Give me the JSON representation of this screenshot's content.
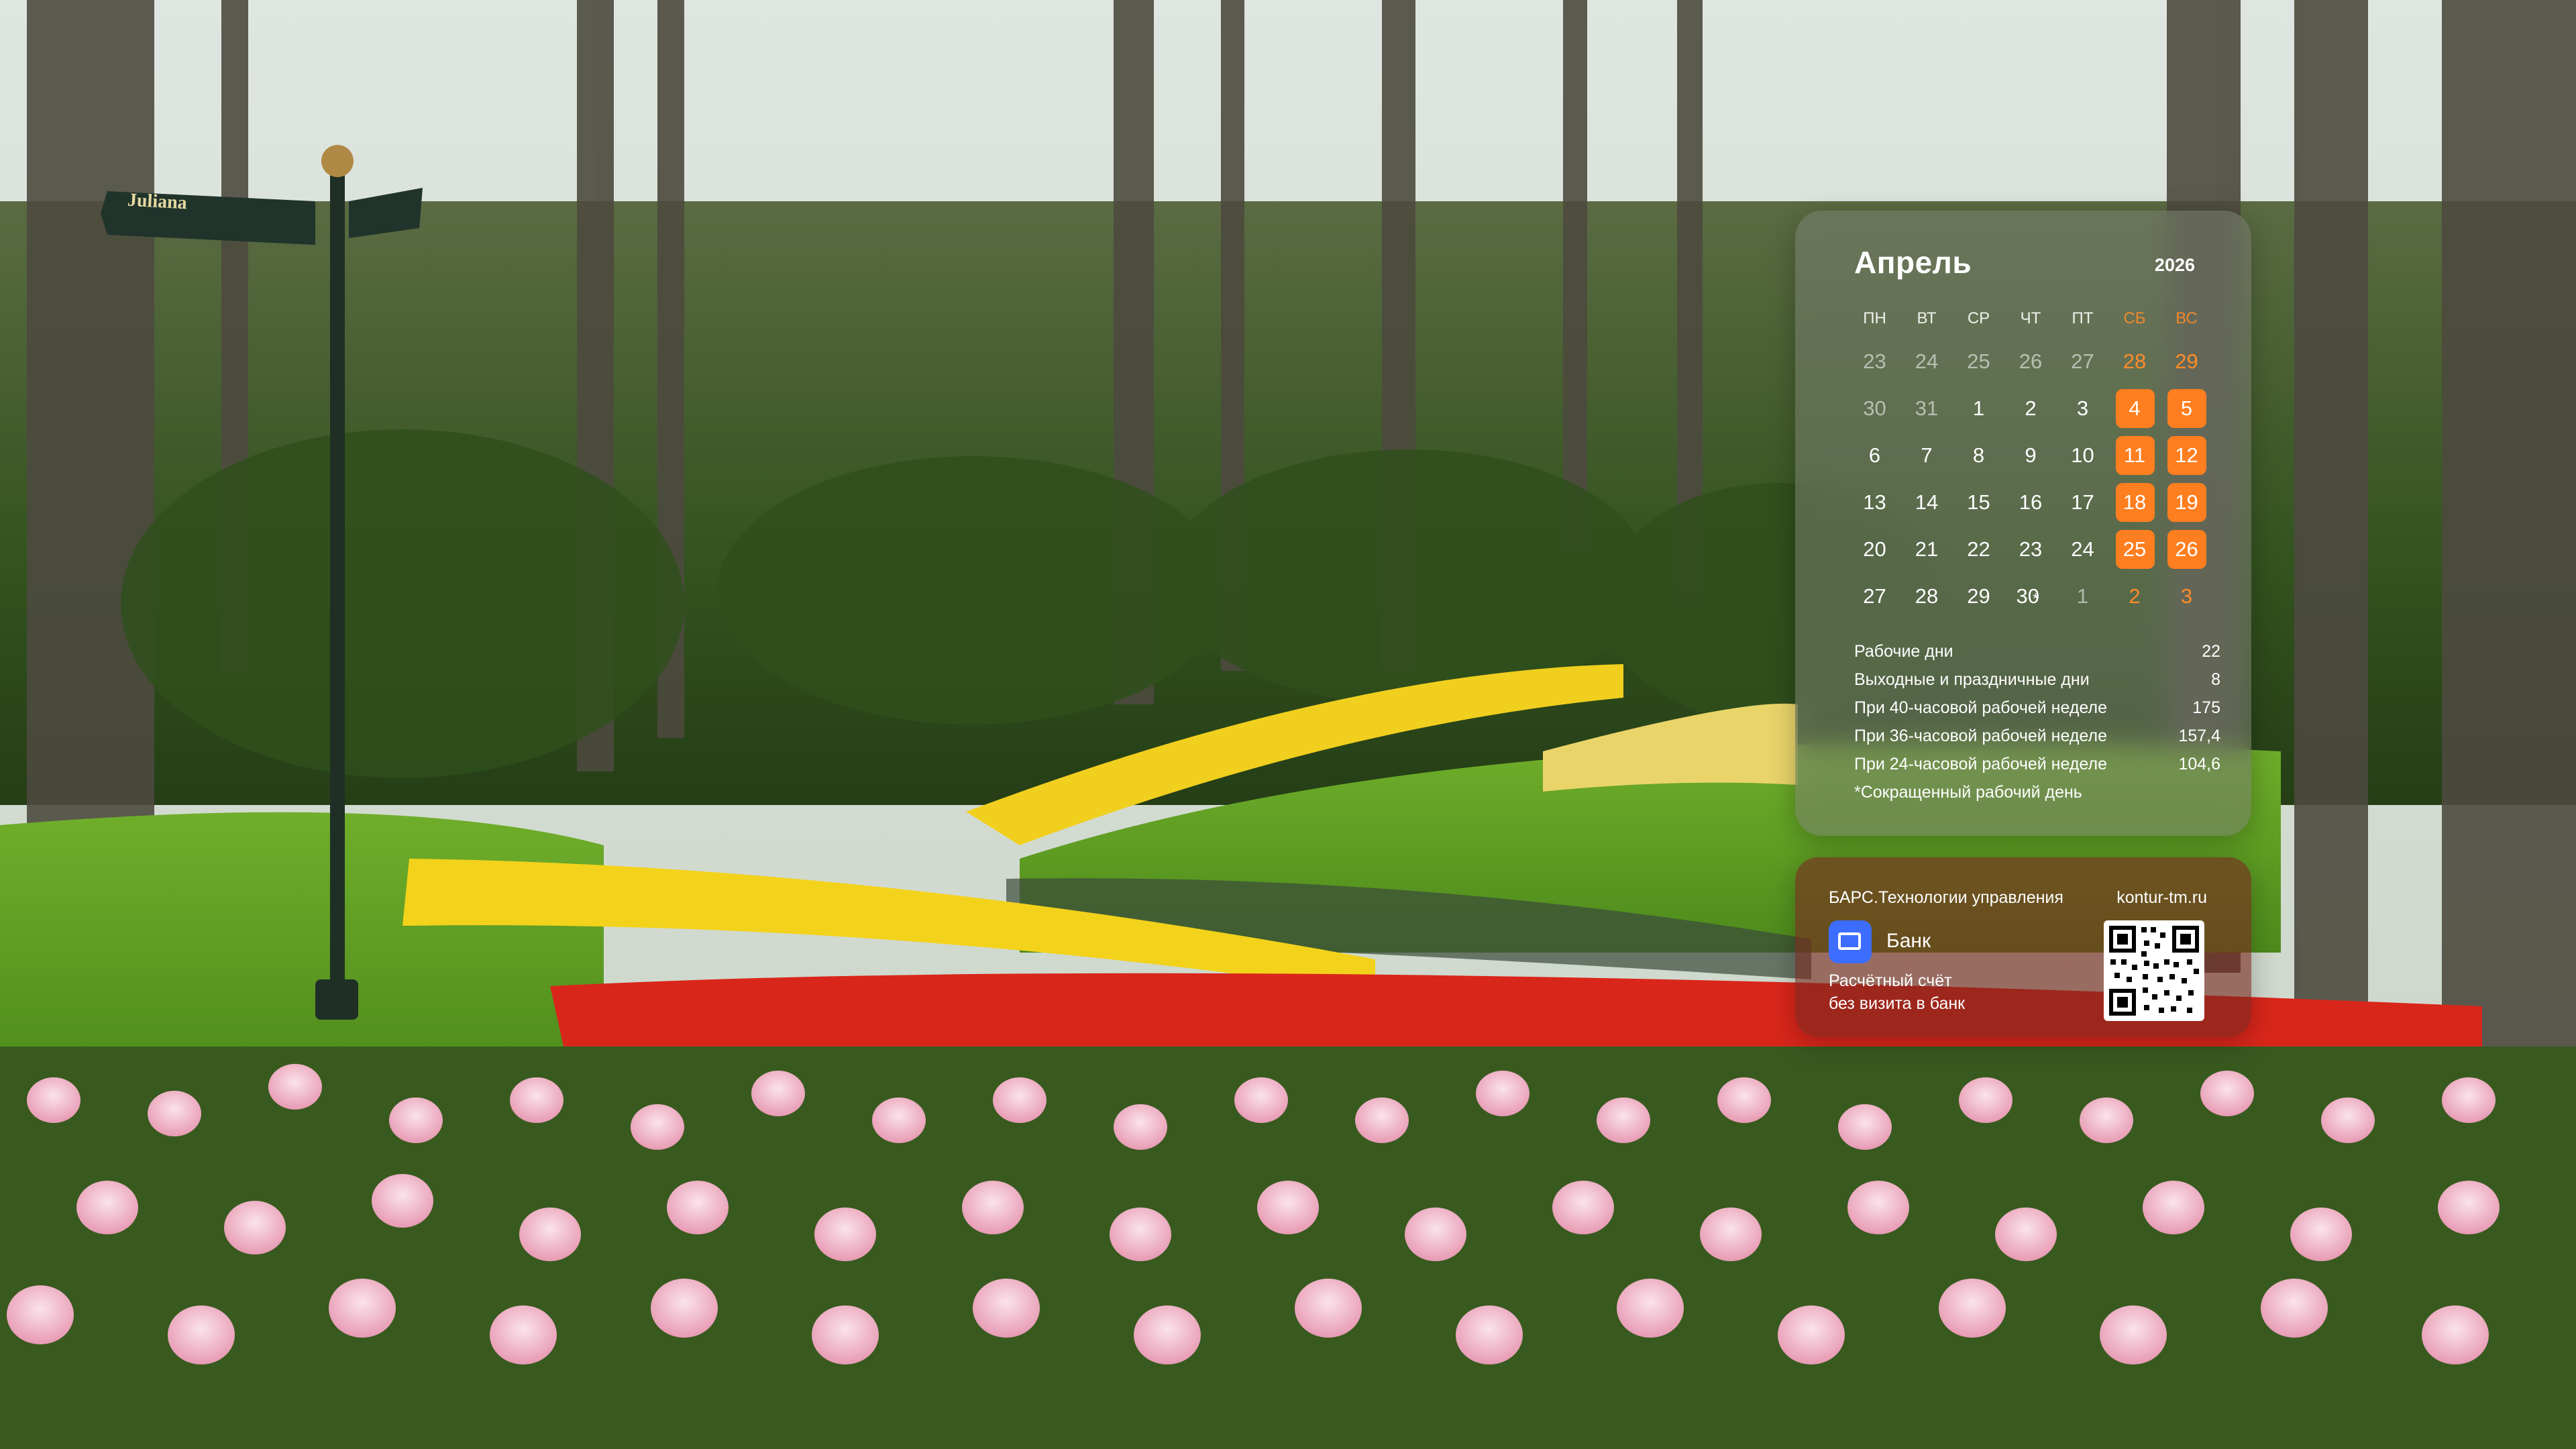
{
  "background": {
    "sign": {
      "text": "Juliana"
    }
  },
  "calendar": {
    "month": "Апрель",
    "year": "2026",
    "weekdays": [
      "ПН",
      "ВТ",
      "СР",
      "ЧТ",
      "ПТ",
      "СБ",
      "ВС"
    ],
    "weeks": [
      [
        "23",
        "24",
        "25",
        "26",
        "27",
        "28",
        "29"
      ],
      [
        "30",
        "31",
        "1",
        "2",
        "3",
        "4",
        "5"
      ],
      [
        "6",
        "7",
        "8",
        "9",
        "10",
        "11",
        "12"
      ],
      [
        "13",
        "14",
        "15",
        "16",
        "17",
        "18",
        "19"
      ],
      [
        "20",
        "21",
        "22",
        "23",
        "24",
        "25",
        "26"
      ],
      [
        "27",
        "28",
        "29",
        "30",
        "1",
        "2",
        "3"
      ]
    ],
    "short_day_marker": "*",
    "stats": [
      {
        "label": "Рабочие дни",
        "value": "22"
      },
      {
        "label": "Выходные и праздничные дни",
        "value": "8"
      },
      {
        "label": "При 40-часовой рабочей неделе",
        "value": "175"
      },
      {
        "label": "При 36-часовой рабочей неделе",
        "value": "157,4"
      },
      {
        "label": "При 24-часовой рабочей неделе",
        "value": "104,6"
      }
    ],
    "note": "*Сокращенный рабочий день",
    "colors": {
      "accent": "#ff7e1f"
    }
  },
  "bank": {
    "company": "БАРС.Технологии управления",
    "site": "kontur-tm.ru",
    "name": "Банк",
    "line1": "Расчётный счёт",
    "line2": "без визита в банк",
    "icon": "card-icon",
    "colors": {
      "icon_bg": "#3d6dff"
    }
  }
}
